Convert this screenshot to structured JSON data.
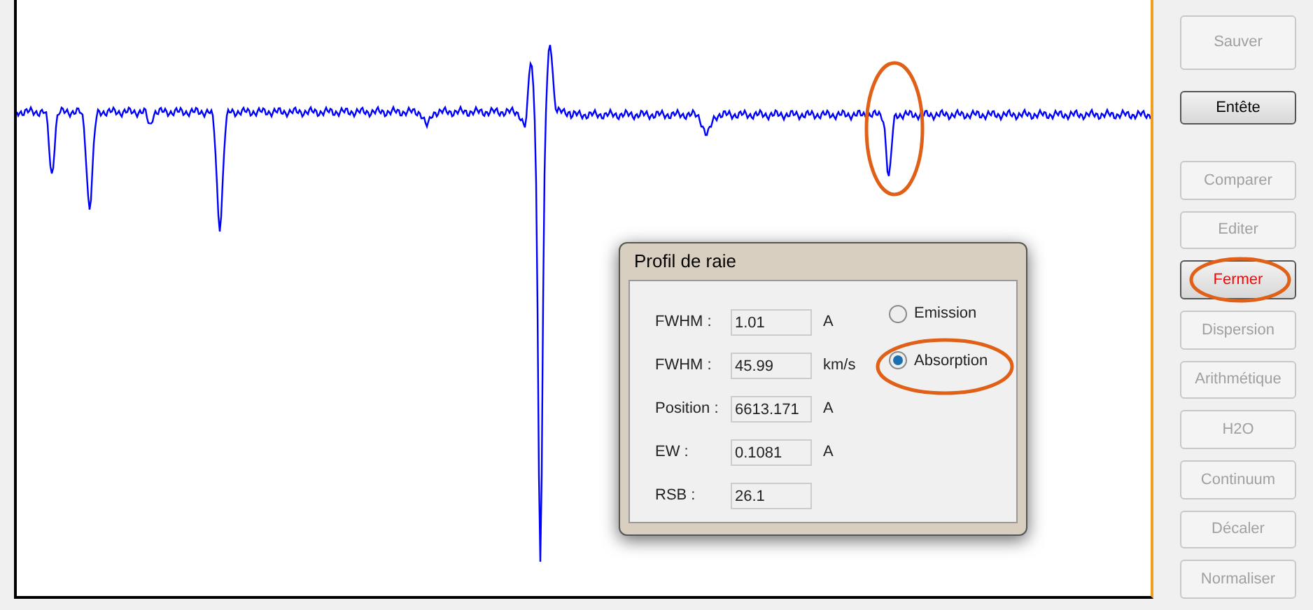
{
  "dialog": {
    "title": "Profil de raie",
    "fields": [
      {
        "label": "FWHM :",
        "value": "1.01",
        "unit": "A"
      },
      {
        "label": "FWHM :",
        "value": "45.99",
        "unit": "km/s"
      },
      {
        "label": "Position :",
        "value": "6613.171",
        "unit": "A"
      },
      {
        "label": "EW :",
        "value": "0.1081",
        "unit": "A"
      },
      {
        "label": "RSB :",
        "value": "26.1"
      }
    ],
    "radios": [
      {
        "label": "Emission",
        "selected": false
      },
      {
        "label": "Absorption",
        "selected": true
      }
    ]
  },
  "buttons": [
    {
      "label": "Sauver",
      "disabled": true,
      "kind": "tall"
    },
    {
      "label": "Entête",
      "disabled": false,
      "kind": "short"
    },
    {
      "label": "Comparer",
      "disabled": true,
      "kind": "normal"
    },
    {
      "label": "Editer",
      "disabled": true,
      "kind": "normal"
    },
    {
      "label": "Fermer",
      "disabled": false,
      "kind": "alert"
    },
    {
      "label": "Dispersion",
      "disabled": true,
      "kind": "normal"
    },
    {
      "label": "Arithmétique",
      "disabled": true,
      "kind": "normal"
    },
    {
      "label": "H2O",
      "disabled": true,
      "kind": "normal"
    },
    {
      "label": "Continuum",
      "disabled": true,
      "kind": "normal"
    },
    {
      "label": "Décaler",
      "disabled": true,
      "kind": "normal"
    },
    {
      "label": "Normaliser",
      "disabled": true,
      "kind": "normal"
    }
  ]
}
